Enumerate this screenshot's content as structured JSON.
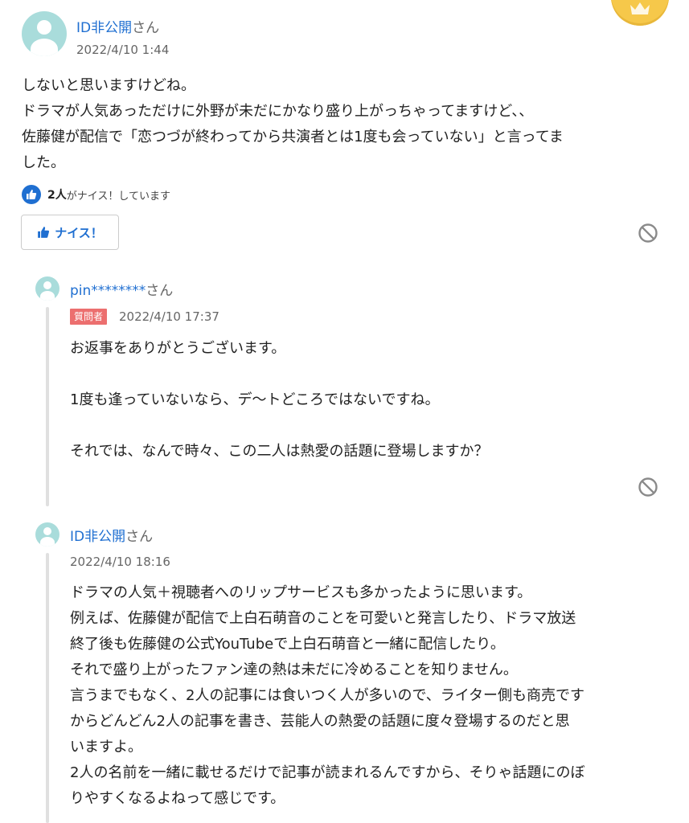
{
  "answer": {
    "user_name": "ID非公開",
    "honorific": "さん",
    "date": "2022/4/10 1:44",
    "body": "しないと思いますけどね。\nドラマが人気あっただけに外野が未だにかなり盛り上がっちゃってますけど、、\n佐藤健が配信で「恋つづが終わってから共演者とは1度も会っていない」と言ってま\nした。",
    "nice_count_number": "2人",
    "nice_count_text": "がナイス！しています",
    "nice_button_label": "ナイス！"
  },
  "reply1": {
    "user_name": "pin********",
    "honorific": "さん",
    "badge": "質問者",
    "date": "2022/4/10 17:37",
    "body": "お返事をありがとうございます。\n\n1度も逢っていないなら、デ〜トどころではないですね。\n\nそれでは、なんで時々、この二人は熱愛の話題に登場しますか？"
  },
  "reply2": {
    "user_name": "ID非公開",
    "honorific": "さん",
    "date": "2022/4/10 18:16",
    "body": "ドラマの人気＋視聴者へのリップサービスも多かったように思います。\n例えば、佐藤健が配信で上白石萌音のことを可愛いと発言したり、ドラマ放送\n終了後も佐藤健の公式YouTubeで上白石萌音と一緒に配信したり。\nそれで盛り上がったファン達の熱は未だに冷めることを知りません。\n言うまでもなく、2人の記事には食いつく人が多いので、ライター側も商売です\nからどんどん2人の記事を書き、芸能人の熱愛の話題に度々登場するのだと思\nいますよ。\n2人の名前を一緒に載せるだけで記事が読まれるんですから、そりゃ話題にのぼ\nりやすくなるよねって感じです。"
  },
  "icons": {
    "crown": "crown-icon",
    "thumb": "thumbs-up-icon",
    "ban": "report-ban-icon",
    "avatar": "default-user-avatar-icon"
  },
  "colors": {
    "link_blue": "#1f6fd1",
    "asker_badge": "#ec6f6f",
    "avatar_teal": "#a9dcdb",
    "crown_gold": "#f6c84a"
  }
}
